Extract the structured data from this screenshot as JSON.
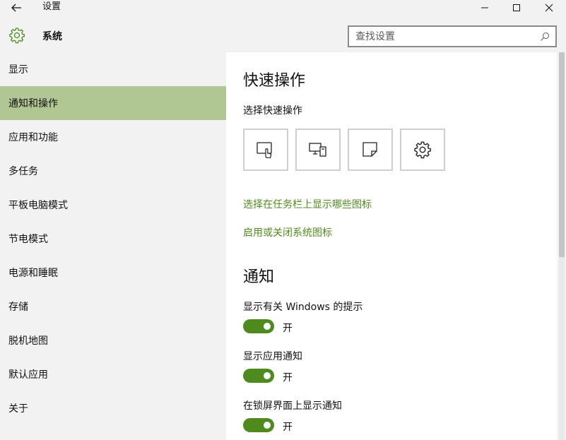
{
  "window": {
    "title": "设置",
    "back_icon": "back-arrow-icon",
    "minimize_icon": "minimize-icon",
    "maximize_icon": "maximize-icon",
    "close_icon": "close-icon"
  },
  "header": {
    "icon": "gear-icon",
    "title": "系统",
    "search_placeholder": "查找设置",
    "search_icon": "search-icon"
  },
  "sidebar": {
    "items": [
      {
        "label": "显示"
      },
      {
        "label": "通知和操作",
        "active": true
      },
      {
        "label": "应用和功能"
      },
      {
        "label": "多任务"
      },
      {
        "label": "平板电脑模式"
      },
      {
        "label": "节电模式"
      },
      {
        "label": "电源和睡眠"
      },
      {
        "label": "存储"
      },
      {
        "label": "脱机地图"
      },
      {
        "label": "默认应用"
      },
      {
        "label": "关于"
      }
    ]
  },
  "main": {
    "quick_actions": {
      "title": "快速操作",
      "subtitle": "选择快速操作",
      "tiles": [
        {
          "icon": "tablet-mode-icon"
        },
        {
          "icon": "connect-icon"
        },
        {
          "icon": "note-icon"
        },
        {
          "icon": "all-settings-icon"
        }
      ],
      "links": [
        "选择在任务栏上显示哪些图标",
        "启用或关闭系统图标"
      ]
    },
    "notifications": {
      "title": "通知",
      "settings": [
        {
          "label": "显示有关 Windows 的提示",
          "state": "开",
          "on": true
        },
        {
          "label": "显示应用通知",
          "state": "开",
          "on": true
        },
        {
          "label": "在锁屏界面上显示通知",
          "state": "开",
          "on": true
        }
      ]
    }
  },
  "colors": {
    "accent": "#4f8a1e",
    "selected": "#b0c793",
    "chrome": "#f2f2f2"
  }
}
